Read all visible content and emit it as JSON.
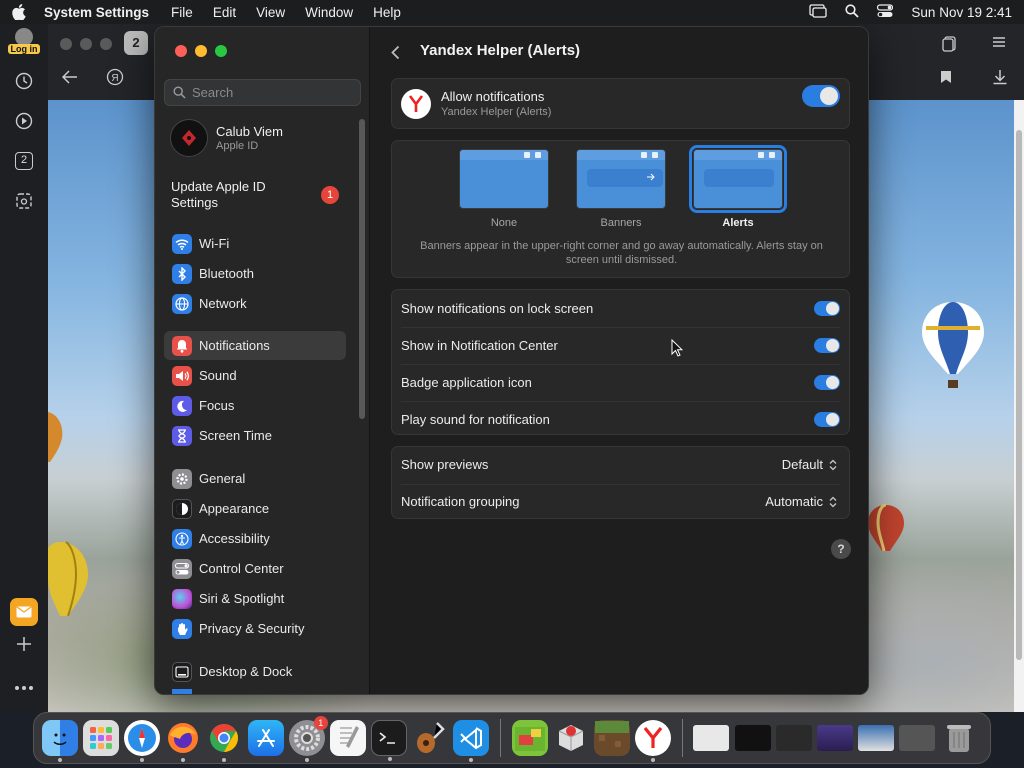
{
  "menubar": {
    "app_name": "System Settings",
    "items": [
      "File",
      "Edit",
      "View",
      "Window",
      "Help"
    ],
    "clock": "Sun Nov 19  2:41"
  },
  "browser": {
    "login_label": "Log in",
    "tab_count": "2",
    "sidebar_counter": "2"
  },
  "sidebar": {
    "search_placeholder": "Search",
    "account": {
      "name": "Calub Viem",
      "subtitle": "Apple ID"
    },
    "update": {
      "label": "Update Apple ID Settings",
      "badge": "1"
    },
    "items": [
      {
        "label": "Wi-Fi",
        "icon": "wifi-icon",
        "color": "#2f7fe6"
      },
      {
        "label": "Bluetooth",
        "icon": "bluetooth-icon",
        "color": "#2f7fe6"
      },
      {
        "label": "Network",
        "icon": "globe-icon",
        "color": "#2f7fe6"
      },
      {
        "label": "Notifications",
        "icon": "bell-icon",
        "color": "#e8504a"
      },
      {
        "label": "Sound",
        "icon": "speaker-icon",
        "color": "#e8504a"
      },
      {
        "label": "Focus",
        "icon": "moon-icon",
        "color": "#5e5ce6"
      },
      {
        "label": "Screen Time",
        "icon": "hourglass-icon",
        "color": "#5e5ce6"
      },
      {
        "label": "General",
        "icon": "gear-icon",
        "color": "#8e8e93"
      },
      {
        "label": "Appearance",
        "icon": "appearance-icon",
        "color": "#1c1c1e"
      },
      {
        "label": "Accessibility",
        "icon": "accessibility-icon",
        "color": "#2f7fe6"
      },
      {
        "label": "Control Center",
        "icon": "control-center-icon",
        "color": "#8e8e93"
      },
      {
        "label": "Siri & Spotlight",
        "icon": "siri-icon",
        "color": "#c04fd6"
      },
      {
        "label": "Privacy & Security",
        "icon": "hand-icon",
        "color": "#2f7fe6"
      },
      {
        "label": "Desktop & Dock",
        "icon": "dock-icon",
        "color": "#1c1c1e"
      }
    ]
  },
  "content": {
    "title": "Yandex Helper (Alerts)",
    "allow": {
      "title": "Allow notifications",
      "subtitle": "Yandex Helper (Alerts)",
      "enabled": true
    },
    "styles": [
      {
        "label": "None",
        "selected": false
      },
      {
        "label": "Banners",
        "selected": false
      },
      {
        "label": "Alerts",
        "selected": true
      }
    ],
    "style_description": "Banners appear in the upper-right corner and go away automatically. Alerts stay on screen until dismissed.",
    "toggles": [
      {
        "label": "Show notifications on lock screen",
        "enabled": true
      },
      {
        "label": "Show in Notification Center",
        "enabled": true
      },
      {
        "label": "Badge application icon",
        "enabled": true
      },
      {
        "label": "Play sound for notification",
        "enabled": true
      }
    ],
    "previews": {
      "label": "Show previews",
      "value": "Default"
    },
    "grouping": {
      "label": "Notification grouping",
      "value": "Automatic"
    },
    "help": "?"
  },
  "dock": {
    "apps": [
      {
        "name": "finder-icon",
        "color": "#3d8fe8"
      },
      {
        "name": "launchpad-icon",
        "color": "#e8b04a"
      },
      {
        "name": "safari-icon",
        "color": "#2a8de8"
      },
      {
        "name": "firefox-icon",
        "color": "#ff7a29"
      },
      {
        "name": "chrome-icon",
        "color": "#34a853"
      },
      {
        "name": "app-store-icon",
        "color": "#2a86f0"
      },
      {
        "name": "system-settings-icon",
        "color": "#8e8e93",
        "badge": "1"
      },
      {
        "name": "textedit-icon",
        "color": "#ececec"
      },
      {
        "name": "terminal-icon",
        "color": "#1c1c1c"
      },
      {
        "name": "guitar-icon",
        "color": "#5b3b26"
      },
      {
        "name": "vscode-icon",
        "color": "#1f8fe6"
      },
      {
        "name": "game-icon",
        "color": "#7ec43b"
      },
      {
        "name": "package-icon",
        "color": "#c84040"
      },
      {
        "name": "minecraft-icon",
        "color": "#5c8a3a"
      },
      {
        "name": "yandex-icon",
        "color": "#ffffff"
      }
    ],
    "windows": [
      {
        "name": "window-thumb-1",
        "color": "#e0e0e0"
      },
      {
        "name": "window-thumb-2",
        "color": "#111111"
      },
      {
        "name": "window-thumb-3",
        "color": "#2a2a2a"
      },
      {
        "name": "window-thumb-4",
        "color": "#4b3a8a"
      },
      {
        "name": "window-thumb-5",
        "color": "#3a6fb0"
      },
      {
        "name": "window-thumb-6",
        "color": "#555555"
      }
    ],
    "trash": "trash-icon"
  }
}
